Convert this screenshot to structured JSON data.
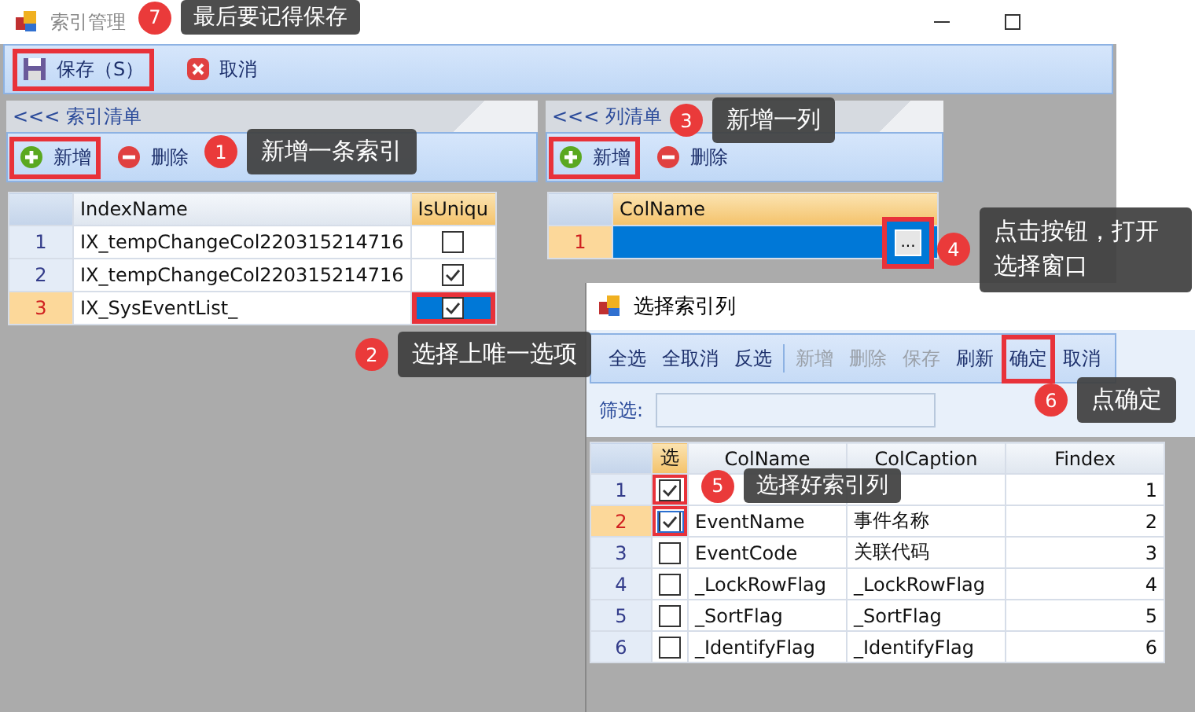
{
  "window": {
    "title": "索引管理"
  },
  "toolbar": [
    {
      "label": "保存（S）",
      "kind": "save",
      "highlighted": true
    },
    {
      "label": "取消",
      "kind": "cancel",
      "highlighted": false
    }
  ],
  "index_panel": {
    "header": "<<< 索引清单",
    "buttons": [
      {
        "label": "新增",
        "kind": "add",
        "highlighted": true
      },
      {
        "label": "删除",
        "kind": "delete",
        "highlighted": false
      }
    ],
    "columns": [
      "IndexName",
      "IsUniqu"
    ],
    "rows": [
      {
        "number": "1",
        "name": "IX_tempChangeCol220315214716",
        "unique": false,
        "selected": false,
        "highlighted": false
      },
      {
        "number": "2",
        "name": "IX_tempChangeCol220315214716",
        "unique": true,
        "selected": false,
        "highlighted": false
      },
      {
        "number": "3",
        "name": "IX_SysEventList_",
        "unique": true,
        "selected": true,
        "highlighted": true
      }
    ]
  },
  "column_panel": {
    "header": "<<< 列清单",
    "buttons": [
      {
        "label": "新增",
        "kind": "add",
        "highlighted": true
      },
      {
        "label": "删除",
        "kind": "delete",
        "highlighted": false
      }
    ],
    "columns": [
      "ColName"
    ],
    "rows": [
      {
        "number": "1",
        "selected": true,
        "button": "...",
        "highlighted": true
      }
    ]
  },
  "dialog": {
    "title": "选择索引列",
    "buttons": [
      {
        "label": "全选",
        "disabled": false,
        "highlighted": false
      },
      {
        "label": "全取消",
        "disabled": false,
        "highlighted": false
      },
      {
        "label": "反选",
        "disabled": false,
        "highlighted": false
      },
      {
        "label": "新增",
        "disabled": true,
        "highlighted": false
      },
      {
        "label": "删除",
        "disabled": true,
        "highlighted": false
      },
      {
        "label": "保存",
        "disabled": true,
        "highlighted": false
      },
      {
        "label": "刷新",
        "disabled": false,
        "highlighted": false
      },
      {
        "label": "确定",
        "disabled": false,
        "highlighted": true
      },
      {
        "label": "取消",
        "disabled": false,
        "highlighted": false
      }
    ],
    "filter_label": "筛选:",
    "columns": [
      "选",
      "ColName",
      "ColCaption",
      "Findex"
    ],
    "rows": [
      {
        "number": "1",
        "checked": true,
        "selected": false,
        "highlighted": true,
        "findex": "1"
      },
      {
        "number": "2",
        "checked": true,
        "selected": true,
        "highlighted": true,
        "col_name": "EventName",
        "caption": "事件名称",
        "findex": "2"
      },
      {
        "number": "3",
        "checked": false,
        "selected": false,
        "highlighted": false,
        "col_name": "EventCode",
        "caption": "关联代码",
        "findex": "3"
      },
      {
        "number": "4",
        "checked": false,
        "selected": false,
        "highlighted": false,
        "col_name": "_LockRowFlag",
        "caption": "_LockRowFlag",
        "findex": "4"
      },
      {
        "number": "5",
        "checked": false,
        "selected": false,
        "highlighted": false,
        "col_name": "_SortFlag",
        "caption": "_SortFlag",
        "findex": "5"
      },
      {
        "number": "6",
        "checked": false,
        "selected": false,
        "highlighted": false,
        "col_name": "_IdentifyFlag",
        "caption": "_IdentifyFlag",
        "findex": "6"
      }
    ]
  },
  "callouts": [
    {
      "number": "1",
      "text": "新增一条索引"
    },
    {
      "number": "2",
      "text": "选择上唯一选项"
    },
    {
      "number": "3",
      "text": "新增一列"
    },
    {
      "number": "4",
      "text": "点击按钮，打开选择窗口"
    },
    {
      "number": "5",
      "text": "选择好索引列"
    },
    {
      "number": "6",
      "text": "点确定"
    },
    {
      "number": "7",
      "text": "最后要记得保存"
    }
  ]
}
